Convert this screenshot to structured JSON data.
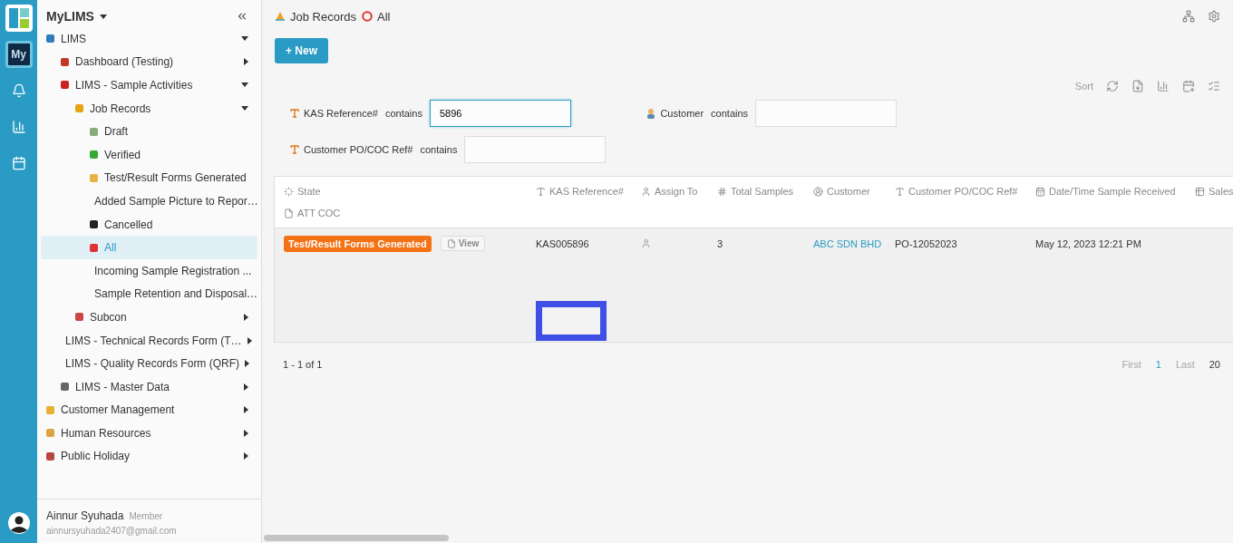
{
  "workspace": {
    "title": "MyLIMS",
    "rail_badge": "My"
  },
  "tree": [
    {
      "label": "LIMS",
      "expanded": true,
      "selected": false,
      "children": [
        {
          "label": "Dashboard (Testing)",
          "expanded": false,
          "selected": false
        },
        {
          "label": "LIMS - Sample Activities",
          "expanded": true,
          "selected": false,
          "children": [
            {
              "label": "Job Records",
              "expanded": true,
              "selected": false,
              "children": [
                {
                  "label": "Draft",
                  "selected": false
                },
                {
                  "label": "Verified",
                  "selected": false
                },
                {
                  "label": "Test/Result Forms Generated",
                  "selected": false
                },
                {
                  "label": "Added Sample Picture to Repor…",
                  "selected": false
                },
                {
                  "label": "Cancelled",
                  "selected": false
                },
                {
                  "label": "All",
                  "selected": true
                },
                {
                  "label": "Incoming Sample Registration ...",
                  "selected": false
                },
                {
                  "label": "Sample Retention and Disposal…",
                  "selected": false
                }
              ]
            },
            {
              "label": "Subcon",
              "expanded": false,
              "selected": false
            }
          ]
        },
        {
          "label": "LIMS - Technical Records Form (T…",
          "expanded": false,
          "selected": false
        },
        {
          "label": "LIMS - Quality Records Form (QRF)",
          "expanded": false,
          "selected": false
        },
        {
          "label": "LIMS - Master Data",
          "expanded": false,
          "selected": false
        }
      ]
    },
    {
      "label": "Customer Management",
      "expanded": false,
      "selected": false
    },
    {
      "label": "Human Resources",
      "expanded": false,
      "selected": false
    },
    {
      "label": "Public Holiday",
      "expanded": false,
      "selected": false
    }
  ],
  "user": {
    "name": "Ainnur Syuhada",
    "role": "Member",
    "email": "ainnursyuhada2407@gmail.com"
  },
  "breadcrumb": [
    "Job Records",
    "All"
  ],
  "new_button": "+ New",
  "sort_label": "Sort",
  "filters": [
    {
      "label": "KAS Reference#",
      "op": "contains",
      "value": "5896",
      "focused": true
    },
    {
      "label": "Customer",
      "op": "contains",
      "focused": false
    },
    {
      "label": "Customer PO/COC Ref#",
      "op": "contains",
      "focused": false
    }
  ],
  "table": {
    "columns": [
      "State",
      "KAS Reference#",
      "Assign To",
      "Total Samples",
      "Customer",
      "Customer PO/COC Ref#",
      "Date/Time Sample Received",
      "Sales",
      "ATT COC"
    ],
    "rows": [
      {
        "state": "Test/Result Forms Generated",
        "view": "View",
        "ref": "KAS005896",
        "total": "3",
        "customer": "ABC SDN BHD",
        "po": "PO-12052023",
        "received": "May 12, 2023 12:21 PM"
      }
    ]
  },
  "pagination": {
    "summary": "1 - 1 of 1",
    "pages": [
      {
        "label": "First",
        "disabled": true,
        "selected": false
      },
      {
        "label": "1",
        "disabled": false,
        "selected": true
      },
      {
        "label": "Last",
        "disabled": true,
        "selected": false
      }
    ],
    "page_size": "20"
  }
}
